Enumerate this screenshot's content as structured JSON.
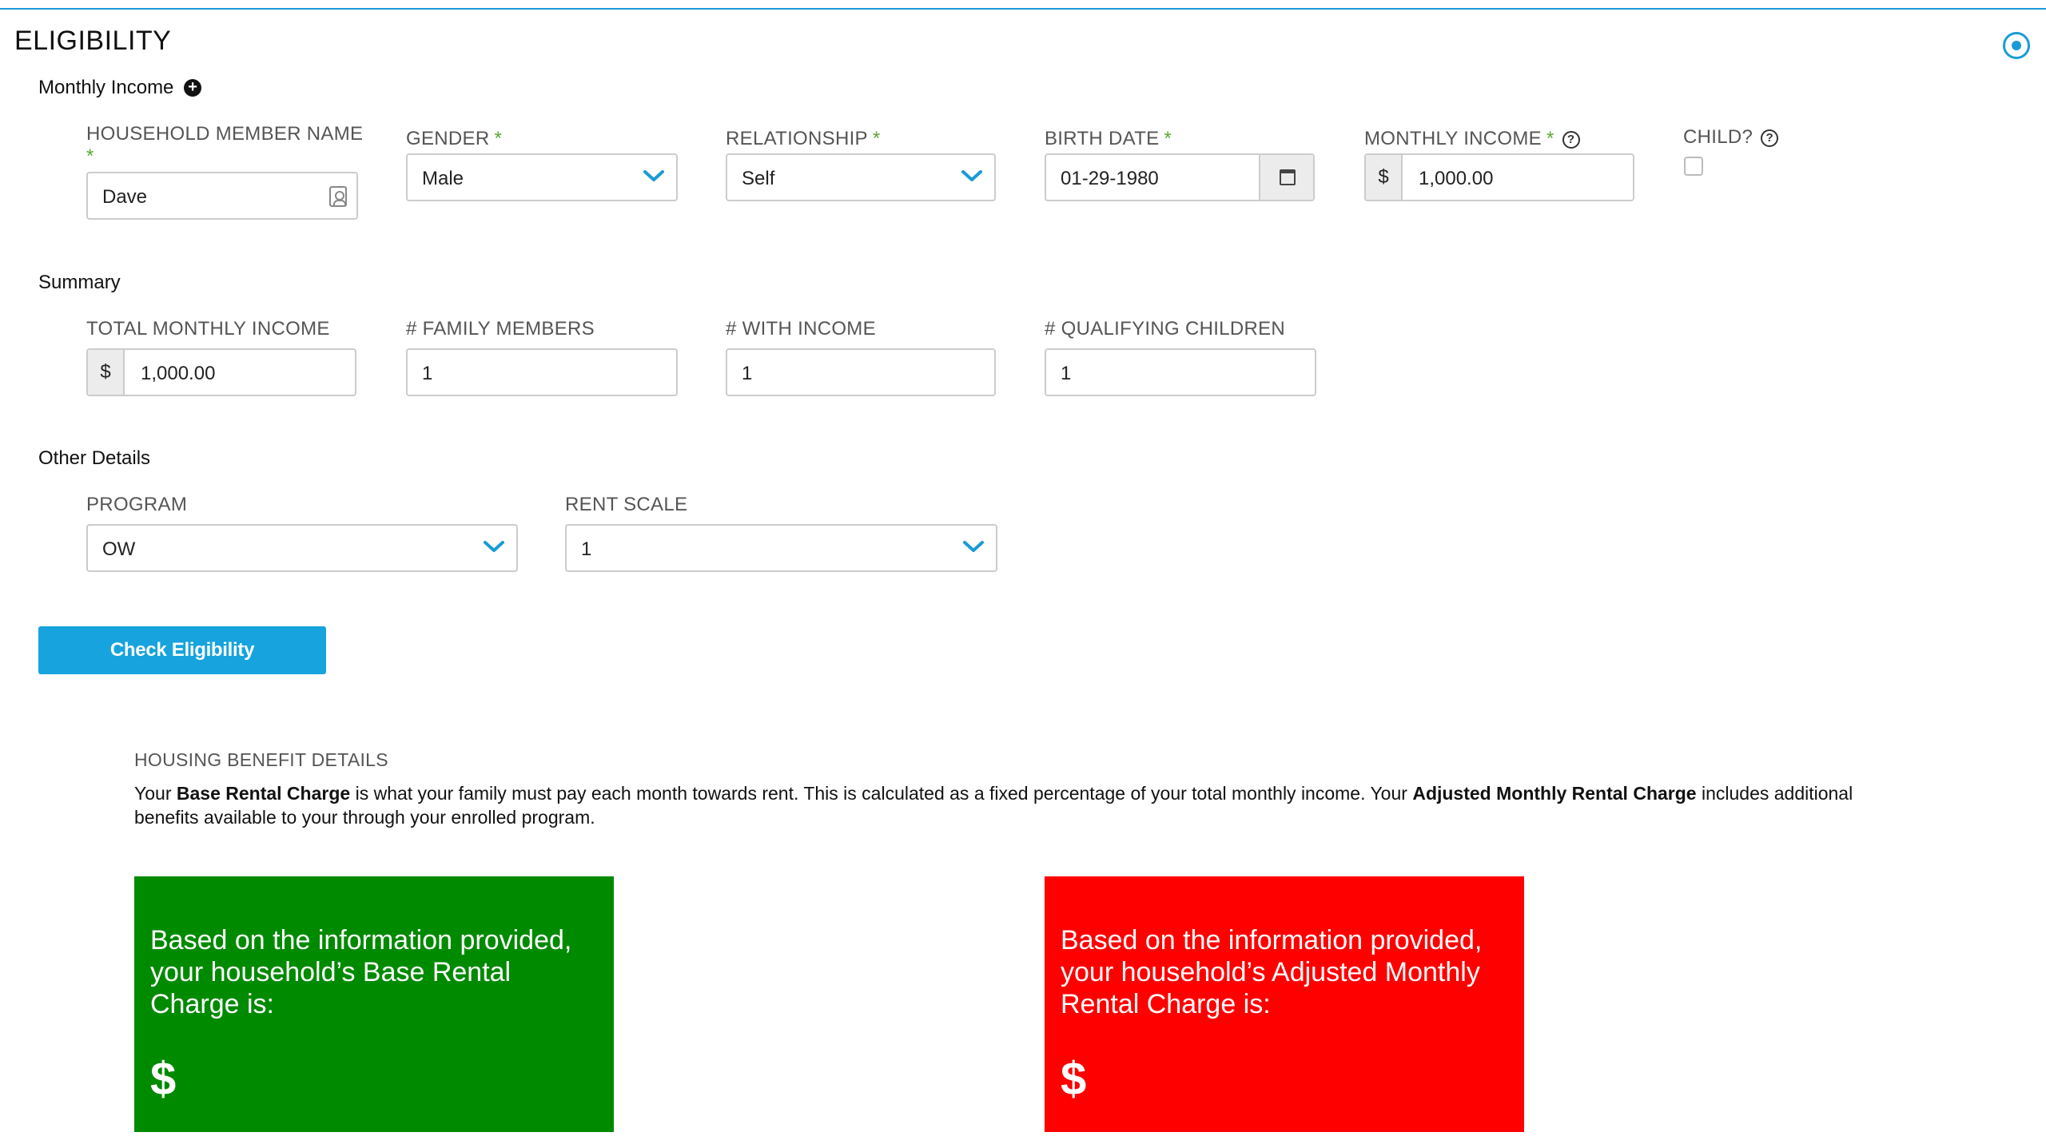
{
  "section": {
    "title": "ELIGIBILITY"
  },
  "monthly_income": {
    "group_label": "Monthly Income",
    "fields": {
      "member_name": {
        "label": "HOUSEHOLD MEMBER NAME",
        "required_mark": "*",
        "value": "Dave"
      },
      "gender": {
        "label": "GENDER",
        "required_mark": "*",
        "value": "Male"
      },
      "relationship": {
        "label": "RELATIONSHIP",
        "required_mark": "*",
        "value": "Self"
      },
      "birth_date": {
        "label": "BIRTH DATE",
        "required_mark": "*",
        "value": "01-29-1980"
      },
      "monthly_income": {
        "label": "MONTHLY INCOME",
        "required_mark": "*",
        "currency": "$",
        "value": "1,000.00"
      },
      "child": {
        "label": "CHILD?",
        "checked": false
      }
    }
  },
  "summary": {
    "group_label": "Summary",
    "total_monthly_income": {
      "label": "TOTAL MONTHLY INCOME",
      "currency": "$",
      "value": "1,000.00"
    },
    "family_members": {
      "label": "# FAMILY MEMBERS",
      "value": "1"
    },
    "with_income": {
      "label": "# WITH INCOME",
      "value": "1"
    },
    "qualifying_children": {
      "label": "# QUALIFYING CHILDREN",
      "value": "1"
    }
  },
  "other_details": {
    "group_label": "Other Details",
    "program": {
      "label": "PROGRAM",
      "value": "OW"
    },
    "rent_scale": {
      "label": "RENT SCALE",
      "value": "1"
    }
  },
  "actions": {
    "check_eligibility": "Check Eligibility"
  },
  "housing_benefit": {
    "heading": "HOUSING BENEFIT DETAILS",
    "desc_1": "Your ",
    "desc_bold_1": "Base Rental Charge",
    "desc_2": " is what your family must pay each month towards rent. This is calculated as a fixed percentage of your total monthly income. Your ",
    "desc_bold_2": "Adjusted Monthly Rental Charge",
    "desc_3": " includes additional benefits available to your through your enrolled program.",
    "base_card": {
      "message": "Based on the information provided, your household’s Base Rental Charge is:",
      "amount": "$"
    },
    "adjusted_card": {
      "message": "Based on the information provided, your household’s Adjusted Monthly Rental Charge is:",
      "amount": "$"
    }
  },
  "colors": {
    "accent": "#16a3de",
    "required": "#5aa832",
    "base_card": "#008a00",
    "adjusted_card": "#ff0000"
  },
  "icons": [
    "collapse-icon",
    "plus-icon",
    "contact-card-icon",
    "chevron-down-icon",
    "calendar-icon",
    "help-icon"
  ]
}
